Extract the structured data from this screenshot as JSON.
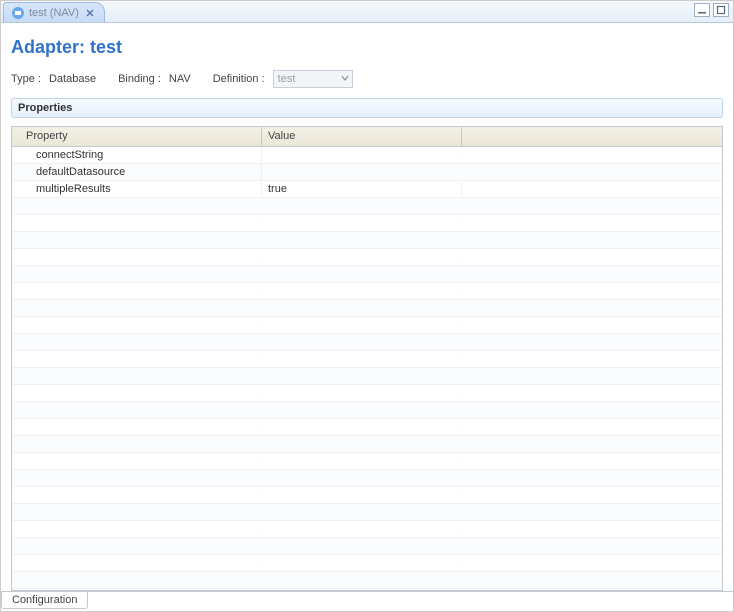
{
  "tab": {
    "title": "test (NAV)"
  },
  "page": {
    "title": "Adapter: test"
  },
  "meta": {
    "type_label": "Type :",
    "type_value": "Database",
    "binding_label": "Binding :",
    "binding_value": "NAV",
    "definition_label": "Definition :",
    "definition_value": "test"
  },
  "section": {
    "title": "Properties"
  },
  "table": {
    "columns": {
      "property": "Property",
      "value": "Value"
    },
    "rows": [
      {
        "property": "connectString",
        "value": ""
      },
      {
        "property": "defaultDatasource",
        "value": ""
      },
      {
        "property": "multipleResults",
        "value": "true"
      }
    ]
  },
  "bottomTabs": {
    "configuration": "Configuration"
  }
}
